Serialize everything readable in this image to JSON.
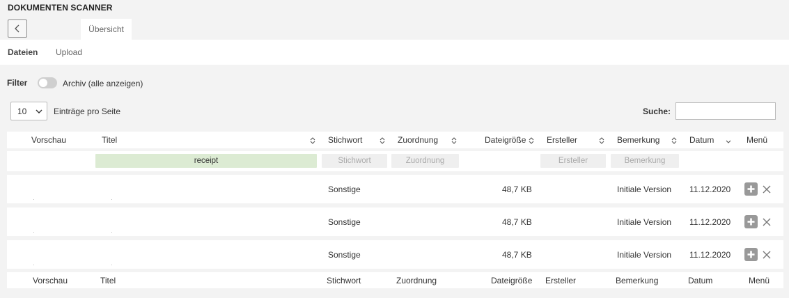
{
  "app": {
    "title": "DOKUMENTEN SCANNER"
  },
  "tabs": {
    "overview": "Übersicht"
  },
  "subnav": {
    "files": "Dateien",
    "upload": "Upload"
  },
  "filter": {
    "label": "Filter",
    "archive_label": "Archiv (alle anzeigen)",
    "archive_enabled": false
  },
  "paging": {
    "per_page_value": "10",
    "per_page_label": "Einträge pro Seite"
  },
  "search": {
    "label": "Suche:",
    "value": ""
  },
  "columns": {
    "preview": "Vorschau",
    "title": "Titel",
    "keyword": "Stichwort",
    "assignment": "Zuordnung",
    "filesize": "Dateigröße",
    "creator": "Ersteller",
    "remark": "Bemerkung",
    "date": "Datum",
    "menu": "Menü"
  },
  "column_filters": {
    "title": "receipt",
    "keyword": "Stichwort",
    "assignment": "Zuordnung",
    "creator": "Ersteller",
    "remark": "Bemerkung"
  },
  "rows": [
    {
      "keyword": "Sonstige",
      "filesize": "48,7 KB",
      "remark": "Initiale Version",
      "date": "11.12.2020"
    },
    {
      "keyword": "Sonstige",
      "filesize": "48,7 KB",
      "remark": "Initiale Version",
      "date": "11.12.2020"
    },
    {
      "keyword": "Sonstige",
      "filesize": "48,7 KB",
      "remark": "Initiale Version",
      "date": "11.12.2020"
    }
  ],
  "icons": {
    "back": "chevron-left-icon",
    "select": "chevron-down-icon",
    "sort": "sort-icon",
    "sort_desc": "sort-desc-icon",
    "add": "plus-icon",
    "delete": "close-icon"
  }
}
